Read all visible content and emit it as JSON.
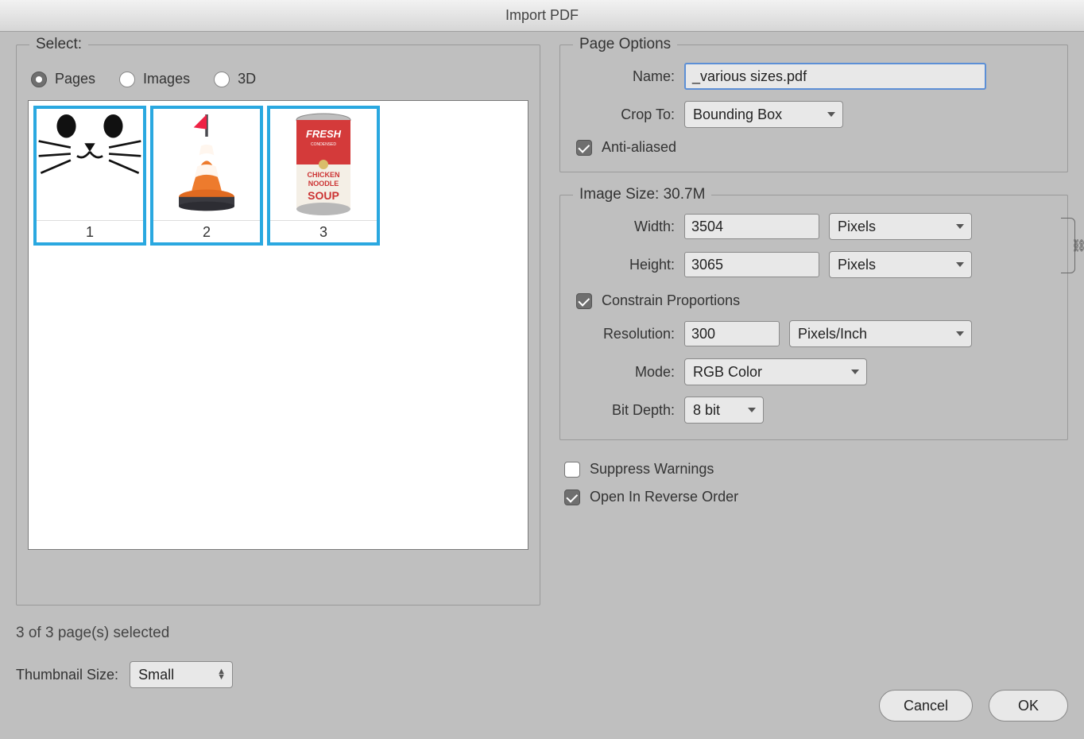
{
  "title": "Import PDF",
  "select": {
    "legend": "Select:",
    "radios": {
      "pages": "Pages",
      "images": "Images",
      "three_d": "3D"
    },
    "thumbs": [
      "1",
      "2",
      "3"
    ],
    "status": "3 of 3 page(s) selected",
    "thumb_size_label": "Thumbnail Size:",
    "thumb_size_value": "Small"
  },
  "page_options": {
    "legend": "Page Options",
    "name_label": "Name:",
    "name_value": "_various sizes.pdf",
    "crop_label": "Crop To:",
    "crop_value": "Bounding Box",
    "antialiased_label": "Anti-aliased"
  },
  "image_size": {
    "legend": "Image Size: 30.7M",
    "width_label": "Width:",
    "width_value": "3504",
    "width_unit": "Pixels",
    "height_label": "Height:",
    "height_value": "3065",
    "height_unit": "Pixels",
    "constrain_label": "Constrain Proportions",
    "resolution_label": "Resolution:",
    "resolution_value": "300",
    "resolution_unit": "Pixels/Inch",
    "mode_label": "Mode:",
    "mode_value": "RGB Color",
    "bitdepth_label": "Bit Depth:",
    "bitdepth_value": "8 bit"
  },
  "suppress_label": "Suppress Warnings",
  "open_reverse_label": "Open In Reverse Order",
  "buttons": {
    "cancel": "Cancel",
    "ok": "OK"
  }
}
